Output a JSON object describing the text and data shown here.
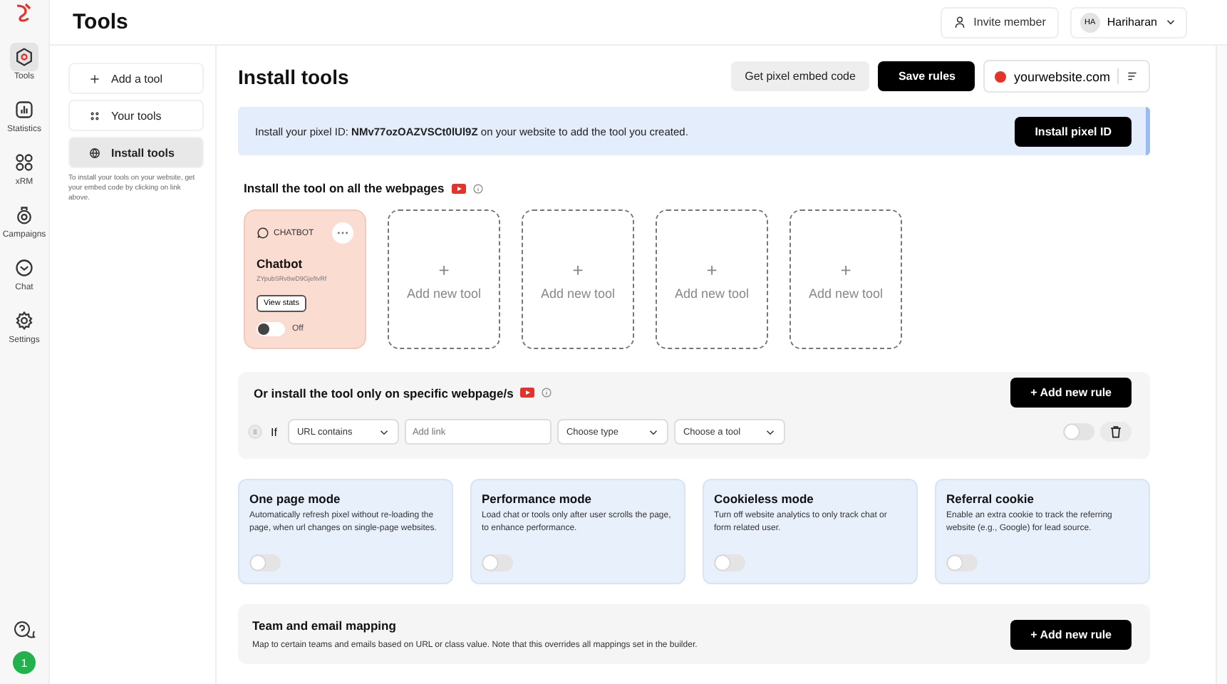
{
  "rail": {
    "items": [
      {
        "label": "Tools",
        "selected": true
      },
      {
        "label": "Statistics",
        "selected": false
      },
      {
        "label": "xRM",
        "selected": false
      },
      {
        "label": "Campaigns",
        "selected": false
      },
      {
        "label": "Chat",
        "selected": false
      },
      {
        "label": "Settings",
        "selected": false
      }
    ],
    "badge": "1"
  },
  "header": {
    "title": "Tools",
    "invite": "Invite member",
    "avatar": "HA",
    "user": "Hariharan"
  },
  "subnav": {
    "items": [
      {
        "label": "Add a tool",
        "selected": false
      },
      {
        "label": "Your tools",
        "selected": false
      },
      {
        "label": "Install tools",
        "selected": true
      }
    ],
    "note": "To install your tools on your website, get your embed code by clicking on link above."
  },
  "main": {
    "title": "Install tools",
    "embed_button": "Get pixel embed code",
    "save_button": "Save rules",
    "website": "yourwebsite.com",
    "banner": {
      "text": "Install your pixel ID: **NMv77ozOAZVSCt0lUl9Z** on your website to add the tool you created.",
      "button": "Install pixel ID"
    },
    "all_pages": {
      "title": "Install the tool on all the webpages",
      "tools": [
        {
          "kind": "tool",
          "tag": "CHATBOT",
          "name": "Chatbot",
          "id": "ZYpubSRv8wD9GjeftvRf",
          "button": "View stats",
          "on": false,
          "state_label": "Off"
        },
        {
          "kind": "add",
          "plus": "+",
          "label": "Add new tool"
        },
        {
          "kind": "add",
          "plus": "+",
          "label": "Add new tool"
        },
        {
          "kind": "add",
          "plus": "+",
          "label": "Add new tool"
        },
        {
          "kind": "add",
          "plus": "+",
          "label": "Add new tool"
        }
      ]
    },
    "specific": {
      "title": "Or install the tool only on specific webpage/s",
      "button": "+ Add new rule",
      "rule": {
        "if": "If",
        "condition": "URL contains",
        "link_placeholder": "Add link",
        "type": "Choose type",
        "tool": "Choose a tool",
        "on": false
      }
    },
    "modes": [
      {
        "title": "One page mode",
        "text": "Automatically refresh pixel without re-loading the page, when url changes on single-page websites.",
        "on": false
      },
      {
        "title": "Performance mode",
        "text": "Load chat or tools only after user scrolls the page, to enhance performance.",
        "on": false
      },
      {
        "title": "Cookieless mode",
        "text": "Turn off website analytics to only track chat or form related user.",
        "on": false
      },
      {
        "title": "Referral cookie",
        "text": "Enable an extra cookie to track the referring website (e.g., Google) for lead source.",
        "on": false
      }
    ],
    "mapping": {
      "title": "Team and email mapping",
      "text": "Map to certain teams and emails based on URL or class value. Note that this overrides all mappings set in the builder.",
      "button": "+ Add new rule"
    }
  }
}
